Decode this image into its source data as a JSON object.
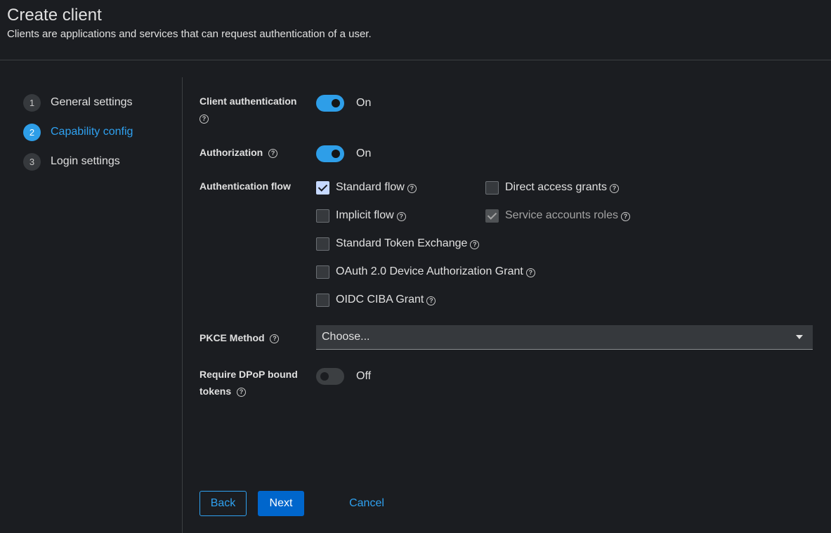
{
  "header": {
    "title": "Create client",
    "subtitle": "Clients are applications and services that can request authentication of a user."
  },
  "steps": [
    {
      "num": "1",
      "label": "General settings",
      "active": false
    },
    {
      "num": "2",
      "label": "Capability config",
      "active": true
    },
    {
      "num": "3",
      "label": "Login settings",
      "active": false
    }
  ],
  "form": {
    "client_auth": {
      "label": "Client authentication",
      "state": "On"
    },
    "authorization": {
      "label": "Authorization",
      "state": "On"
    },
    "auth_flow": {
      "label": "Authentication flow",
      "options": [
        {
          "label": "Standard flow",
          "checked": true,
          "disabled": false
        },
        {
          "label": "Direct access grants",
          "checked": false,
          "disabled": false
        },
        {
          "label": "Implicit flow",
          "checked": false,
          "disabled": false
        },
        {
          "label": "Service accounts roles",
          "checked": true,
          "disabled": true
        },
        {
          "label": "Standard Token Exchange",
          "checked": false,
          "disabled": false
        },
        {
          "label": "OAuth 2.0 Device Authorization Grant",
          "checked": false,
          "disabled": false
        },
        {
          "label": "OIDC CIBA Grant",
          "checked": false,
          "disabled": false
        }
      ]
    },
    "pkce": {
      "label": "PKCE Method",
      "value": "Choose..."
    },
    "dpop": {
      "label_line1": "Require DPoP bound",
      "label_line2": "tokens",
      "state": "Off"
    }
  },
  "buttons": {
    "back": "Back",
    "next": "Next",
    "cancel": "Cancel"
  },
  "help_glyph": "?",
  "colors": {
    "accent": "#2e9ee8",
    "primary_button": "#0066cc",
    "background": "#1b1d21"
  }
}
